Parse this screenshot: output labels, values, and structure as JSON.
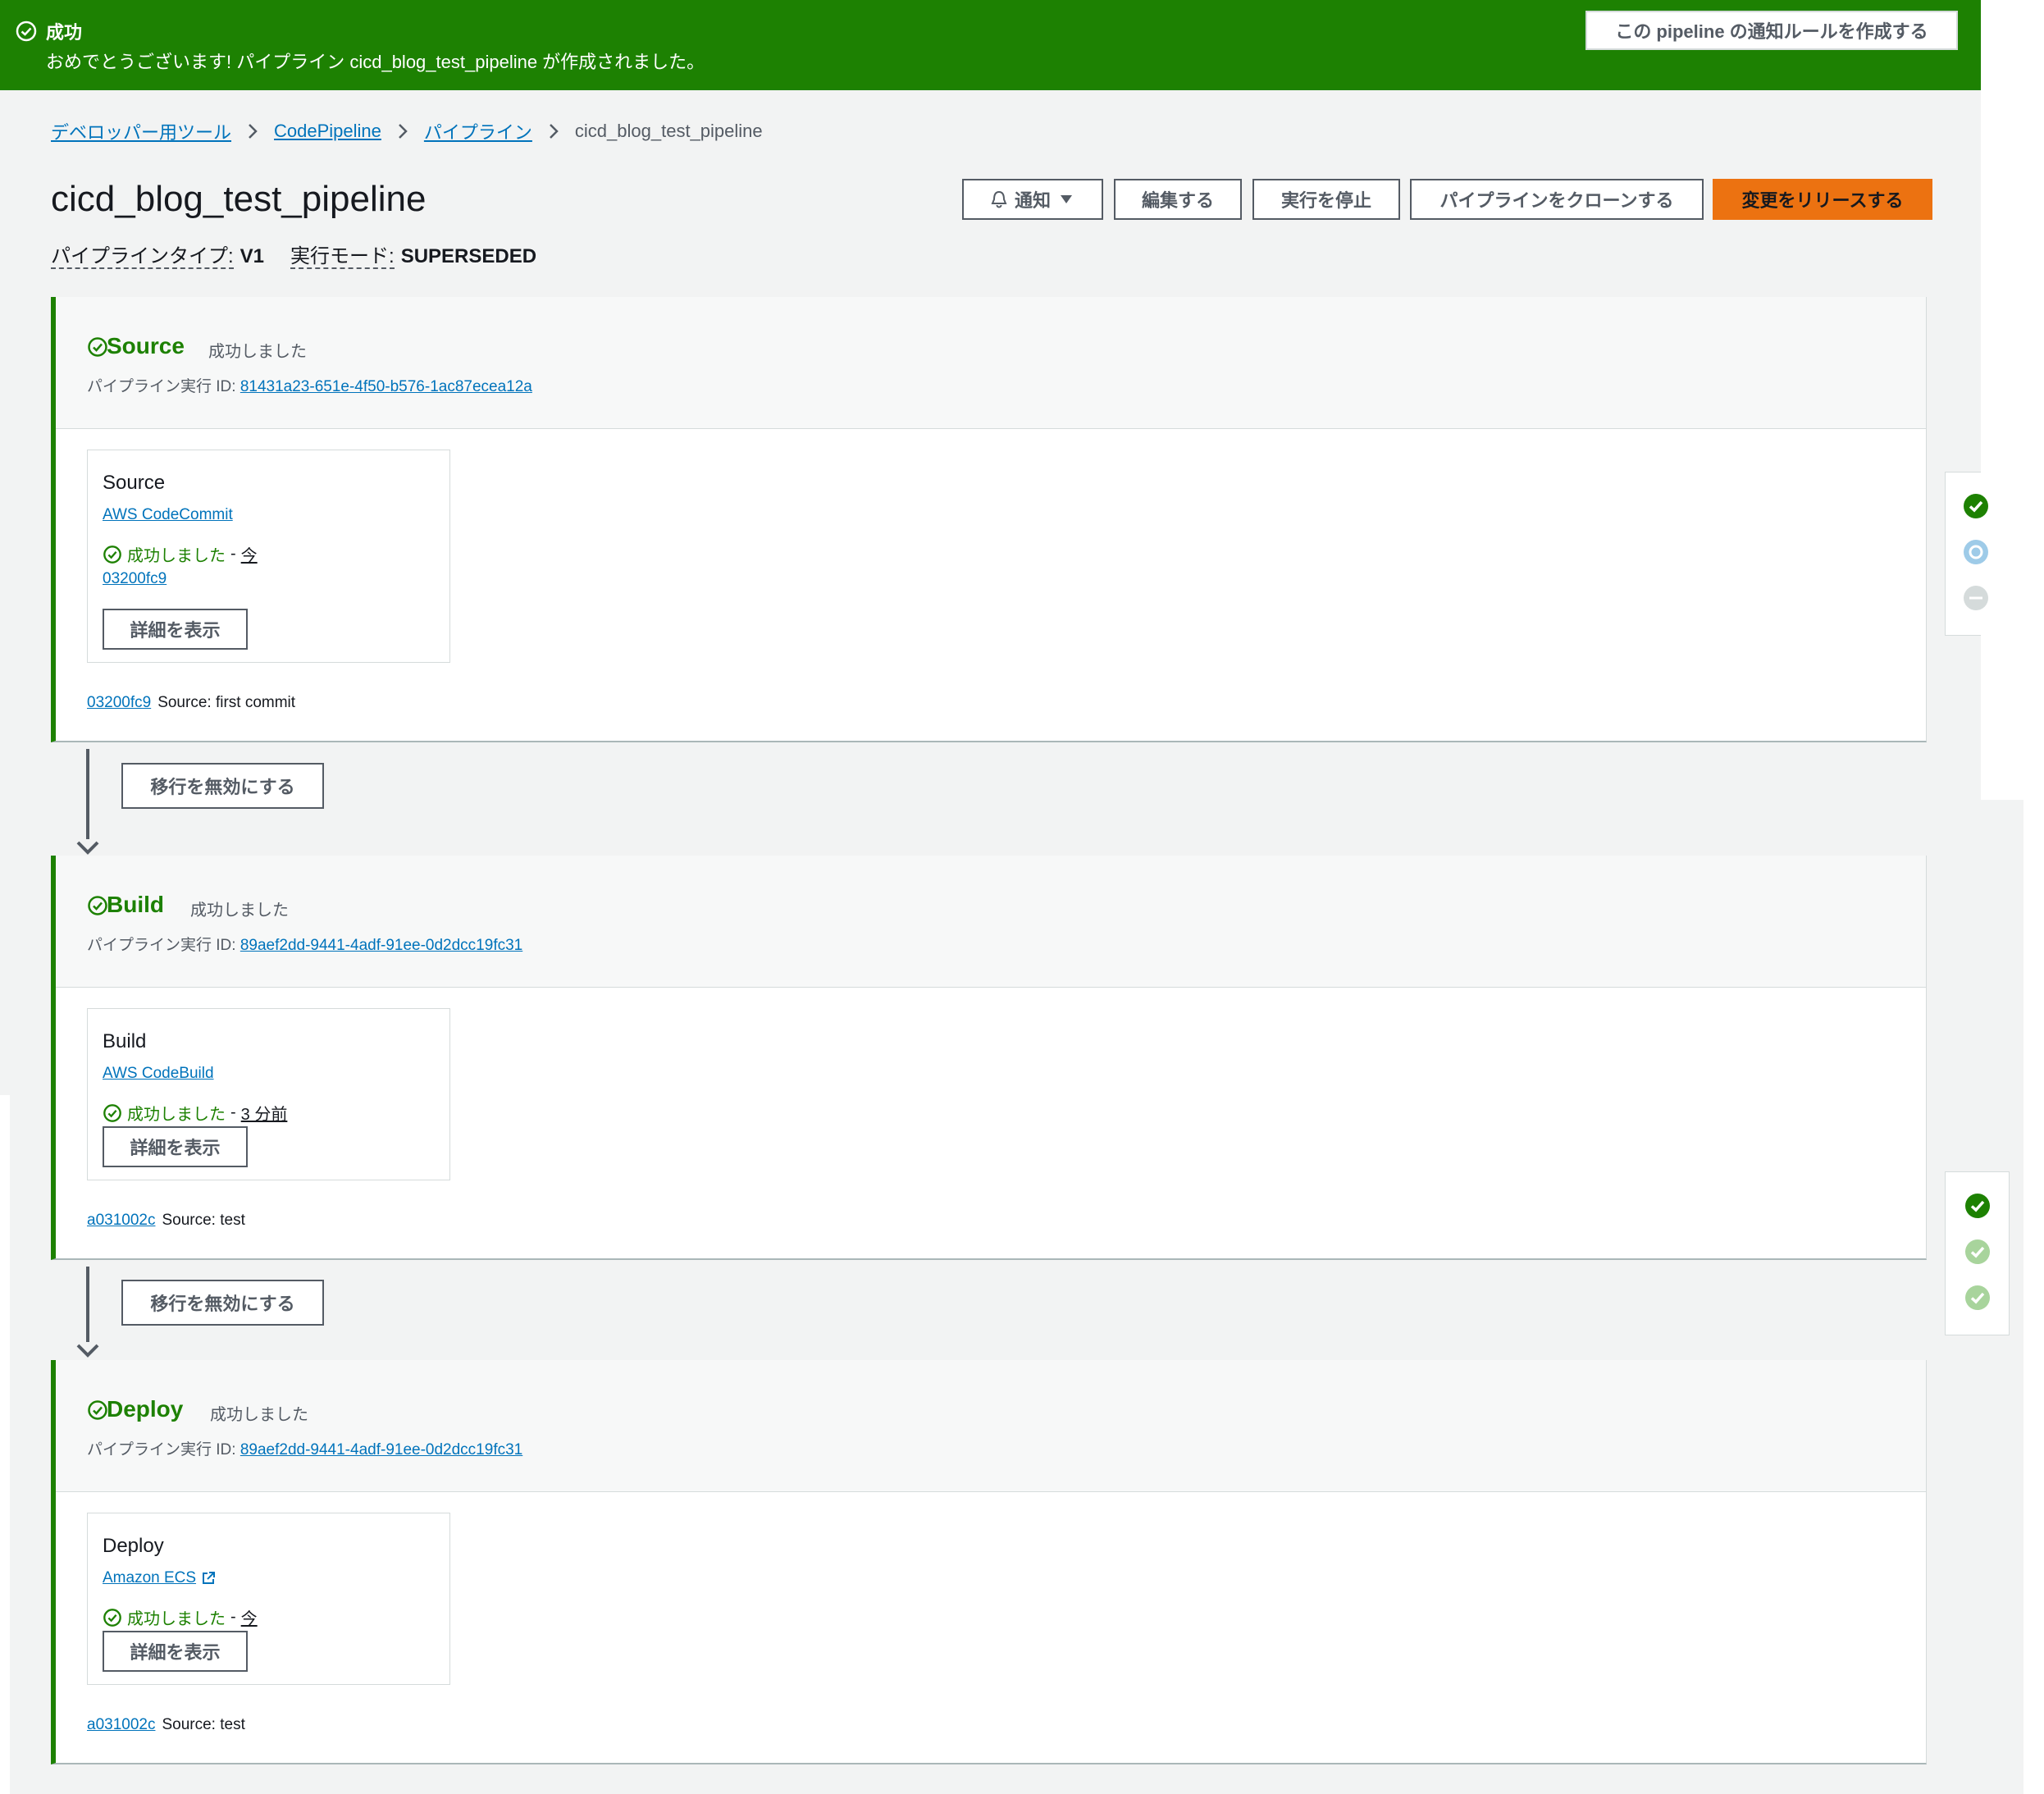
{
  "flash": {
    "title": "成功",
    "message": "おめでとうございます! パイプライン cicd_blog_test_pipeline が作成されました。",
    "button": "この pipeline の通知ルールを作成する",
    "color": "#1d8102"
  },
  "breadcrumb": [
    {
      "label": "デベロッパー用ツール"
    },
    {
      "label": "CodePipeline"
    },
    {
      "label": "パイプライン"
    },
    {
      "label": "cicd_blog_test_pipeline"
    }
  ],
  "header": {
    "title": "cicd_blog_test_pipeline",
    "pipeline_type_label": "パイプラインタイプ:",
    "pipeline_type_value": "V1",
    "exec_mode_label": "実行モード:",
    "exec_mode_value": "SUPERSEDED",
    "buttons": {
      "notify": "通知",
      "edit": "編集する",
      "stop": "実行を停止",
      "clone": "パイプラインをクローンする",
      "release": "変更をリリースする"
    },
    "accent": "#ec7211"
  },
  "stages": [
    {
      "name": "Source",
      "status": "成功しました",
      "exec_label": "パイプライン実行 ID:",
      "exec_id": "81431a23-651e-4f50-b576-1ac87ecea12a",
      "action": {
        "name": "Source",
        "provider": "AWS CodeCommit",
        "status": "成功しました",
        "when": "今",
        "revision": "03200fc9",
        "details_button": "詳細を表示"
      },
      "commit_id": "03200fc9",
      "commit_msg": "Source: first commit"
    },
    {
      "name": "Build",
      "status": "成功しました",
      "exec_label": "パイプライン実行 ID:",
      "exec_id": "89aef2dd-9441-4adf-91ee-0d2dcc19fc31",
      "action": {
        "name": "Build",
        "provider": "AWS CodeBuild",
        "status": "成功しました",
        "when": "3 分前",
        "details_button": "詳細を表示"
      },
      "commit_id": "a031002c",
      "commit_msg": "Source: test"
    },
    {
      "name": "Deploy",
      "status": "成功しました",
      "exec_label": "パイプライン実行 ID:",
      "exec_id": "89aef2dd-9441-4adf-91ee-0d2dcc19fc31",
      "action": {
        "name": "Deploy",
        "provider": "Amazon ECS",
        "status": "成功しました",
        "when": "今",
        "details_button": "詳細を表示"
      },
      "commit_id": "a031002c",
      "commit_msg": "Source: test"
    }
  ],
  "transitions": [
    {
      "label": "移行を無効にする"
    },
    {
      "label": "移行を無効にする"
    }
  ],
  "colors": {
    "success": "#1d8102",
    "link": "#0073bb",
    "in_progress": "#9ecbe8",
    "disabled": "#d5dbdb",
    "light_success": "#a8d49c"
  }
}
